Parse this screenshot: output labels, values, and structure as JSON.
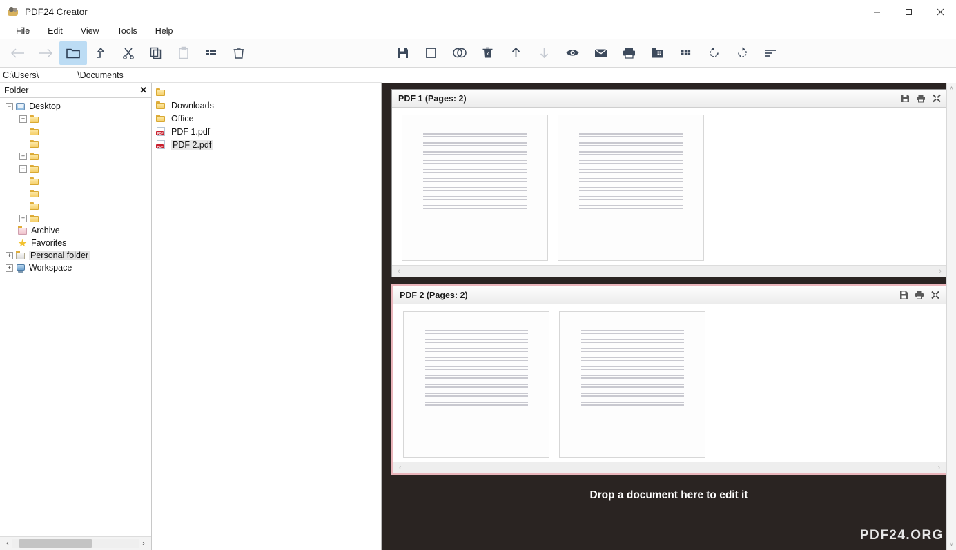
{
  "window": {
    "title": "PDF24 Creator",
    "app_icon": "pdf24-logo-icon",
    "controls": {
      "minimize": "—",
      "maximize": "☐",
      "close": "✕"
    }
  },
  "menubar": {
    "items": [
      "File",
      "Edit",
      "View",
      "Tools",
      "Help"
    ]
  },
  "toolbar_left": [
    {
      "name": "back-icon",
      "enabled": false
    },
    {
      "name": "forward-icon",
      "enabled": false
    },
    {
      "name": "folder-icon",
      "enabled": true,
      "active": true
    },
    {
      "name": "move-up-icon",
      "enabled": true
    },
    {
      "name": "cut-icon",
      "enabled": true
    },
    {
      "name": "copy-icon",
      "enabled": true
    },
    {
      "name": "paste-icon",
      "enabled": false
    },
    {
      "name": "grid-view-icon",
      "enabled": true
    },
    {
      "name": "delete-icon",
      "enabled": true
    }
  ],
  "toolbar_right": [
    {
      "name": "save-icon",
      "enabled": true
    },
    {
      "name": "select-page-icon",
      "enabled": true
    },
    {
      "name": "merge-icon",
      "enabled": true
    },
    {
      "name": "delete-page-icon",
      "enabled": true
    },
    {
      "name": "move-up-icon",
      "enabled": true
    },
    {
      "name": "move-down-icon",
      "enabled": false
    },
    {
      "name": "preview-icon",
      "enabled": true
    },
    {
      "name": "email-icon",
      "enabled": true
    },
    {
      "name": "print-icon",
      "enabled": true
    },
    {
      "name": "fax-icon",
      "enabled": true
    },
    {
      "name": "page-grid-icon",
      "enabled": true
    },
    {
      "name": "rotate-left-icon",
      "enabled": true
    },
    {
      "name": "rotate-right-icon",
      "enabled": true
    },
    {
      "name": "properties-icon",
      "enabled": true
    }
  ],
  "path_bar": {
    "prefix": "C:\\Users\\",
    "suffix": "\\Documents"
  },
  "folder_pane": {
    "title": "Folder",
    "close_label": "✕",
    "root": {
      "label": "Desktop",
      "icon": "desktop-icon",
      "expander": "−"
    },
    "children": [
      {
        "label": "",
        "icon": "folder-icon",
        "expander": "+"
      },
      {
        "label": "",
        "icon": "folder-icon",
        "expander": ""
      },
      {
        "label": "",
        "icon": "folder-icon",
        "expander": ""
      },
      {
        "label": "",
        "icon": "folder-icon",
        "expander": "+"
      },
      {
        "label": "",
        "icon": "folder-icon",
        "expander": "+"
      },
      {
        "label": "",
        "icon": "folder-icon",
        "expander": ""
      },
      {
        "label": "",
        "icon": "folder-icon",
        "expander": ""
      },
      {
        "label": "",
        "icon": "folder-icon",
        "expander": ""
      },
      {
        "label": "",
        "icon": "folder-icon",
        "expander": "+"
      }
    ],
    "roots": [
      {
        "label": "Archive",
        "icon": "archive-folder-icon",
        "expander": "",
        "selected": false
      },
      {
        "label": "Favorites",
        "icon": "favorites-star-icon",
        "expander": "",
        "selected": false
      },
      {
        "label": "Personal folder",
        "icon": "personal-folder-icon",
        "expander": "+",
        "selected": true
      },
      {
        "label": "Workspace",
        "icon": "workspace-icon",
        "expander": "+",
        "selected": false
      }
    ],
    "scroll": {
      "left_arrow": "‹",
      "right_arrow": "›"
    }
  },
  "file_list": [
    {
      "label": "",
      "icon": "folder-icon",
      "selected": false
    },
    {
      "label": "Downloads",
      "icon": "folder-icon",
      "selected": false
    },
    {
      "label": "Office",
      "icon": "folder-icon",
      "selected": false
    },
    {
      "label": "PDF 1.pdf",
      "icon": "pdf-file-icon",
      "selected": false
    },
    {
      "label": "PDF 2.pdf",
      "icon": "pdf-file-icon",
      "selected": true
    }
  ],
  "documents": [
    {
      "title": "PDF 1 (Pages: 2)",
      "selected": false,
      "actions": [
        "save-icon",
        "print-icon",
        "close-icon"
      ],
      "page_count": 2,
      "scroll": {
        "left_arrow": "‹",
        "right_arrow": "›"
      }
    },
    {
      "title": "PDF 2 (Pages: 2)",
      "selected": true,
      "actions": [
        "save-icon",
        "print-icon",
        "close-icon"
      ],
      "page_count": 2,
      "scroll": {
        "left_arrow": "‹",
        "right_arrow": "›"
      }
    }
  ],
  "dropzone": {
    "text": "Drop a document here to edit it"
  },
  "watermark": {
    "text": "PDF24.ORG"
  },
  "vertical_scrollbar": {
    "up_arrow": "˄",
    "down_arrow": "˅"
  },
  "colors": {
    "viewer_background": "#2a2422",
    "selected_panel_border": "#eab5bb",
    "toolbar_active": "#bcdcf4",
    "pdf_red": "#c8202e",
    "folder_yellow": "#f5cf6a"
  }
}
